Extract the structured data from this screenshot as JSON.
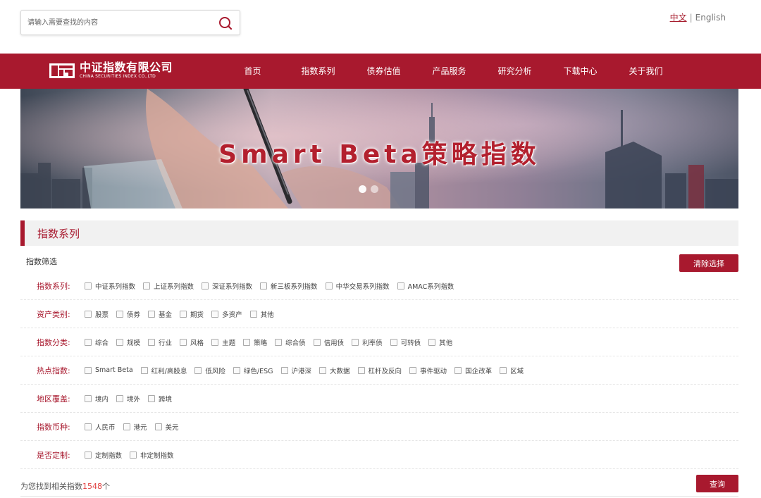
{
  "search": {
    "placeholder": "请输入需要查找的内容",
    "icon": "search-icon"
  },
  "lang": {
    "zh": "中文",
    "sep": "|",
    "en": "English"
  },
  "logo": {
    "cn": "中证指数有限公司",
    "en": "CHINA SECURITIES INDEX CO.,LTD"
  },
  "nav": {
    "home": "首页",
    "index_series": "指数系列",
    "bond_valuation": "债券估值",
    "product_service": "产品服务",
    "research": "研究分析",
    "download": "下载中心",
    "about": "关于我们"
  },
  "banner": {
    "title": "Smart Beta策略指数",
    "slides": 2,
    "active_slide": 1
  },
  "section": {
    "title": "指数系列"
  },
  "filter": {
    "label": "指数筛选",
    "clear_button": "清除选择",
    "rows": {
      "series": {
        "label": "指数系列:",
        "options": [
          "中证系列指数",
          "上证系列指数",
          "深证系列指数",
          "新三板系列指数",
          "中华交易系列指数",
          "AMAC系列指数"
        ]
      },
      "asset": {
        "label": "资产类别:",
        "options": [
          "股票",
          "债券",
          "基金",
          "期货",
          "多资产",
          "其他"
        ]
      },
      "category": {
        "label": "指数分类:",
        "options": [
          "综合",
          "规模",
          "行业",
          "风格",
          "主题",
          "策略",
          "综合债",
          "信用债",
          "利率债",
          "可转债",
          "其他"
        ]
      },
      "hot": {
        "label": "热点指数:",
        "options": [
          "Smart Beta",
          "红利/高股息",
          "低风险",
          "绿色/ESG",
          "沪港深",
          "大数据",
          "杠杆及反向",
          "事件驱动",
          "国企改革",
          "区域"
        ]
      },
      "region": {
        "label": "地区覆盖:",
        "options": [
          "境内",
          "境外",
          "跨境"
        ]
      },
      "currency": {
        "label": "指数币种:",
        "options": [
          "人民币",
          "港元",
          "美元"
        ]
      },
      "custom": {
        "label": "是否定制:",
        "options": [
          "定制指数",
          "非定制指数"
        ]
      }
    }
  },
  "result": {
    "prefix": "为您找到相关指数",
    "count": "1548",
    "suffix": "个",
    "query_button": "查询"
  },
  "colors": {
    "brand": "#a8192e",
    "count": "#e03c3c"
  }
}
